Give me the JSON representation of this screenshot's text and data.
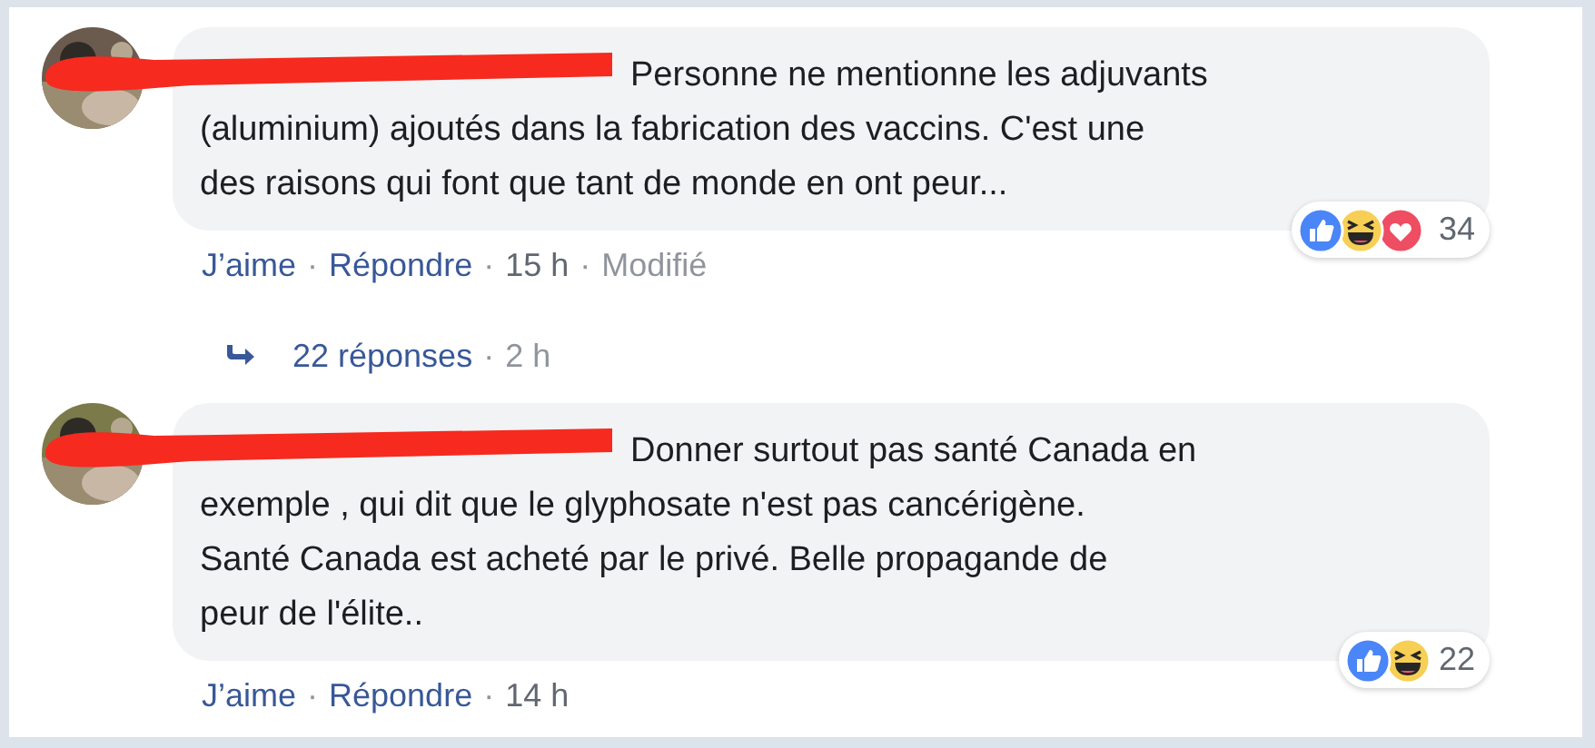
{
  "comments": [
    {
      "avatar": {
        "kind": "picture"
      },
      "text_lines": [
        "Personne ne mentionne les adjuvants",
        "(aluminium) ajoutés dans la fabrication des vaccins. C'est une",
        "des raisons qui font que tant de monde en ont peur..."
      ],
      "reactions": [
        {
          "kind": "like"
        },
        {
          "kind": "haha"
        },
        {
          "kind": "love"
        }
      ],
      "reaction_count": "34",
      "meta": [
        {
          "kind": "link",
          "text": "J’aime"
        },
        {
          "kind": "sep",
          "text": "·"
        },
        {
          "kind": "link",
          "text": "Répondre"
        },
        {
          "kind": "sep",
          "text": "·"
        },
        {
          "kind": "muted",
          "text": "15 h"
        },
        {
          "kind": "sep",
          "text": "·"
        },
        {
          "kind": "faint",
          "text": "Modifié"
        }
      ],
      "replies": {
        "count": "22 réponses",
        "separator": "·",
        "time": "2 h"
      }
    },
    {
      "avatar": {
        "kind": "picture"
      },
      "text_lines": [
        "Donner surtout pas santé Canada en",
        "exemple , qui dit que le glyphosate n'est pas cancérigène.",
        "Santé Canada est acheté par le privé. Belle propagande de",
        "peur de l'élite.."
      ],
      "reactions": [
        {
          "kind": "like"
        },
        {
          "kind": "haha"
        }
      ],
      "reaction_count": "22",
      "meta": [
        {
          "kind": "link",
          "text": "J’aime"
        },
        {
          "kind": "sep",
          "text": "·"
        },
        {
          "kind": "link",
          "text": "Répondre"
        },
        {
          "kind": "sep",
          "text": "·"
        },
        {
          "kind": "muted",
          "text": "14 h"
        }
      ]
    }
  ]
}
